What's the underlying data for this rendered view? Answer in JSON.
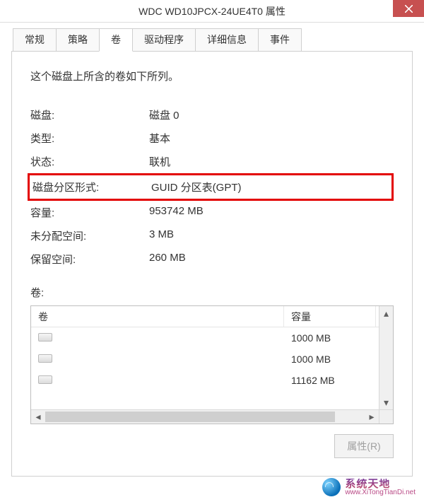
{
  "window": {
    "title": "WDC WD10JPCX-24UE4T0 属性"
  },
  "tabs": {
    "general": "常规",
    "policies": "策略",
    "volumes": "卷",
    "driver": "驱动程序",
    "details": "详细信息",
    "events": "事件"
  },
  "active_tab": 2,
  "intro": "这个磁盘上所含的卷如下所列。",
  "rows": {
    "disk_label": "磁盘:",
    "disk_value": "磁盘 0",
    "type_label": "类型:",
    "type_value": "基本",
    "status_label": "状态:",
    "status_value": "联机",
    "partstyle_label": "磁盘分区形式:",
    "partstyle_value": "GUID 分区表(GPT)",
    "capacity_label": "容量:",
    "capacity_value": "953742 MB",
    "unalloc_label": "未分配空间:",
    "unalloc_value": "3 MB",
    "reserved_label": "保留空间:",
    "reserved_value": "260 MB"
  },
  "volume_section_label": "卷:",
  "table": {
    "col_volume": "卷",
    "col_capacity": "容量",
    "rows": [
      {
        "capacity": "1000 MB"
      },
      {
        "capacity": "1000 MB"
      },
      {
        "capacity": "11162 MB"
      }
    ]
  },
  "buttons": {
    "properties": "属性(R)"
  },
  "watermark": {
    "top": "系统天地",
    "bottom": "www.XiTongTianDi.net"
  }
}
